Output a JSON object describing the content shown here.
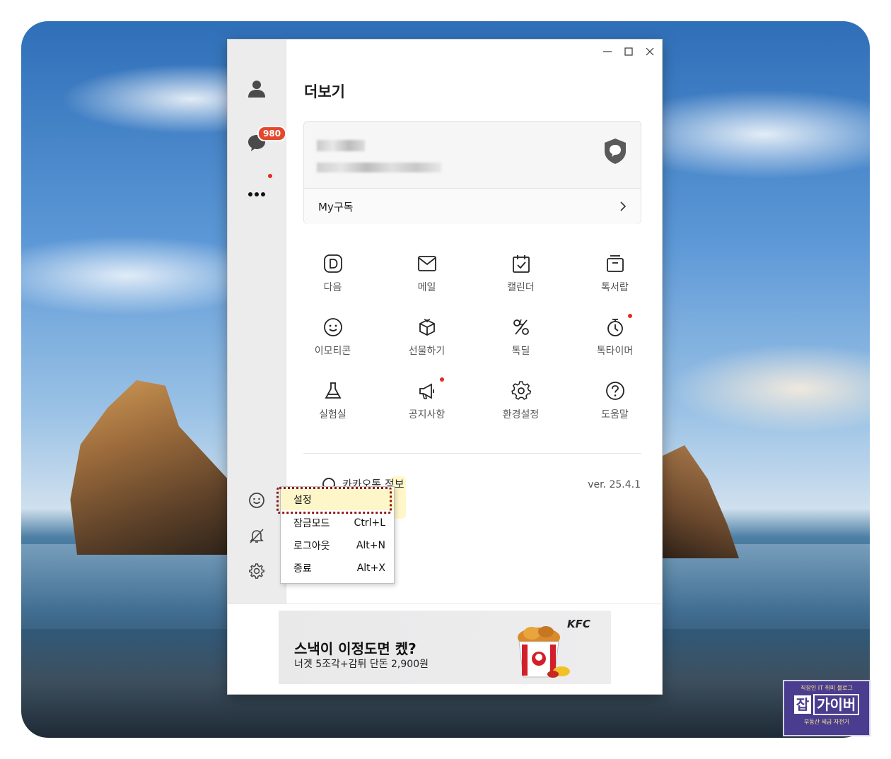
{
  "window": {
    "title": "더보기",
    "controls": [
      "minimize",
      "maximize",
      "close"
    ]
  },
  "sidebar": {
    "unread_count": "980",
    "items": [
      {
        "icon": "person-icon",
        "name": "friends"
      },
      {
        "icon": "chat-icon",
        "name": "chats"
      },
      {
        "icon": "more-icon",
        "name": "more"
      }
    ],
    "bottom_items": [
      {
        "icon": "emoji-icon"
      },
      {
        "icon": "bell-off-icon"
      },
      {
        "icon": "gear-icon"
      }
    ]
  },
  "profile": {
    "subscription_label": "My구독"
  },
  "grid": [
    {
      "label": "다음",
      "icon": "daum-icon"
    },
    {
      "label": "메일",
      "icon": "mail-icon"
    },
    {
      "label": "캘린더",
      "icon": "calendar-icon"
    },
    {
      "label": "톡서랍",
      "icon": "drawer-icon"
    },
    {
      "label": "이모티콘",
      "icon": "emoticon-icon"
    },
    {
      "label": "선물하기",
      "icon": "gift-icon"
    },
    {
      "label": "톡딜",
      "icon": "percent-icon"
    },
    {
      "label": "톡타이머",
      "icon": "timer-icon"
    },
    {
      "label": "실험실",
      "icon": "flask-icon"
    },
    {
      "label": "공지사항",
      "icon": "megaphone-icon"
    },
    {
      "label": "환경설정",
      "icon": "settings-icon"
    },
    {
      "label": "도움말",
      "icon": "help-icon"
    }
  ],
  "about": {
    "label": "카카오톡 정보",
    "version": "ver. 25.4.1"
  },
  "context_menu": {
    "items": [
      {
        "label": "설정",
        "shortcut": ""
      },
      {
        "label": "잠금모드",
        "shortcut": "Ctrl+L"
      },
      {
        "label": "로그아웃",
        "shortcut": "Alt+N"
      },
      {
        "label": "종료",
        "shortcut": "Alt+X"
      }
    ]
  },
  "ad": {
    "headline": "스낵이 이정도면 켔?",
    "subline": "너겟 5조각+감튀 단돈 2,900원",
    "brand": "KFC"
  },
  "watermark": {
    "top": "직장인 IT 취미 블로그",
    "logo_a": "잡",
    "logo_b": "가이버",
    "bottom": "부동산 세금 자전거"
  },
  "colors": {
    "badge_red": "#e3482d",
    "dot_red": "#e42b20",
    "highlight_border": "#8a1b1b"
  }
}
